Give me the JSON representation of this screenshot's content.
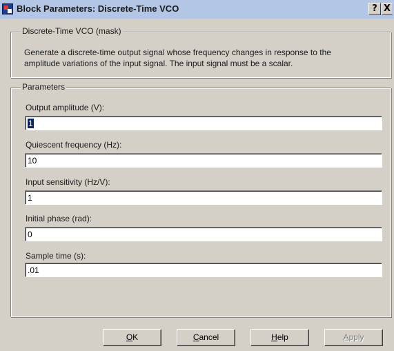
{
  "window": {
    "title": "Block Parameters: Discrete-Time VCO",
    "help_glyph": "?",
    "close_glyph": "X"
  },
  "mask": {
    "legend": "Discrete-Time VCO (mask)",
    "description_line1": "Generate a discrete-time output signal whose frequency changes in response to the",
    "description_line2": "amplitude variations of the input signal. The input signal must be a scalar."
  },
  "parameters": {
    "legend": "Parameters",
    "fields": [
      {
        "label": "Output amplitude (V):",
        "value": "1"
      },
      {
        "label": "Quiescent frequency (Hz):",
        "value": "10"
      },
      {
        "label": "Input sensitivity (Hz/V):",
        "value": "1"
      },
      {
        "label": "Initial phase (rad):",
        "value": "0"
      },
      {
        "label": "Sample time (s):",
        "value": ".01"
      }
    ]
  },
  "buttons": {
    "ok_mnemonic": "O",
    "ok_rest": "K",
    "cancel_mnemonic": "C",
    "cancel_rest": "ancel",
    "help_mnemonic": "H",
    "help_rest": "elp",
    "apply_mnemonic": "A",
    "apply_rest": "pply"
  }
}
